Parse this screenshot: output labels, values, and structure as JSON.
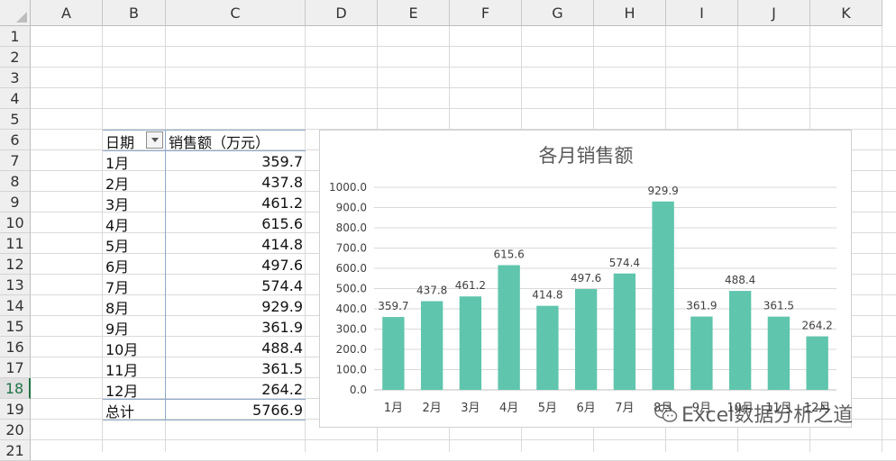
{
  "columns": [
    "A",
    "B",
    "C",
    "D",
    "E",
    "F",
    "G",
    "H",
    "I",
    "J",
    "K"
  ],
  "rows": [
    "1",
    "2",
    "3",
    "4",
    "5",
    "6",
    "7",
    "8",
    "9",
    "10",
    "11",
    "12",
    "13",
    "14",
    "15",
    "16",
    "17",
    "18",
    "19",
    "20",
    "21"
  ],
  "selected_row": "18",
  "pivot": {
    "header_date": "日期",
    "header_sales": "销售额（万元）",
    "items": [
      {
        "month": "1月",
        "value": "359.7"
      },
      {
        "month": "2月",
        "value": "437.8"
      },
      {
        "month": "3月",
        "value": "461.2"
      },
      {
        "month": "4月",
        "value": "615.6"
      },
      {
        "month": "5月",
        "value": "414.8"
      },
      {
        "month": "6月",
        "value": "497.6"
      },
      {
        "month": "7月",
        "value": "574.4"
      },
      {
        "month": "8月",
        "value": "929.9"
      },
      {
        "month": "9月",
        "value": "361.9"
      },
      {
        "month": "10月",
        "value": "488.4"
      },
      {
        "month": "11月",
        "value": "361.5"
      },
      {
        "month": "12月",
        "value": "264.2"
      }
    ],
    "total_label": "总计",
    "total_value": "5766.9"
  },
  "chart_data": {
    "type": "bar",
    "title": "各月销售额",
    "categories": [
      "1月",
      "2月",
      "3月",
      "4月",
      "5月",
      "6月",
      "7月",
      "8月",
      "9月",
      "10月",
      "11月",
      "12月"
    ],
    "values": [
      359.7,
      437.8,
      461.2,
      615.6,
      414.8,
      497.6,
      574.4,
      929.9,
      361.9,
      488.4,
      361.5,
      264.2
    ],
    "ylim": [
      0,
      1000
    ],
    "yticks": [
      "0.0",
      "100.0",
      "200.0",
      "300.0",
      "400.0",
      "500.0",
      "600.0",
      "700.0",
      "800.0",
      "900.0",
      "1000.0"
    ],
    "data_labels": [
      "359.7",
      "437.8",
      "461.2",
      "615.6",
      "414.8",
      "497.6",
      "574.4",
      "929.9",
      "361.9",
      "488.4",
      "361.5",
      "264.2"
    ],
    "bar_color": "#5fc5ad",
    "grid": true,
    "legend": "none"
  },
  "watermark": {
    "text": "Excel数据分析之道",
    "icon": "wechat-icon"
  }
}
